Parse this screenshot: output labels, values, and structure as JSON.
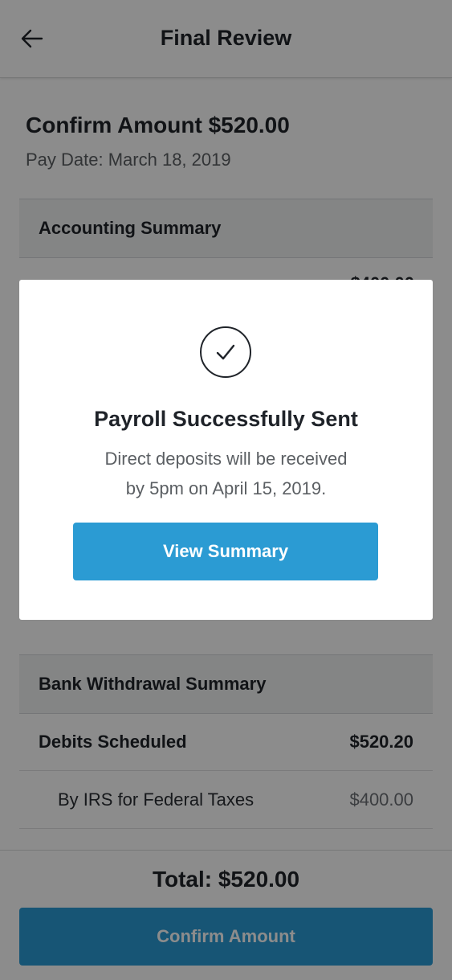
{
  "header": {
    "title": "Final Review",
    "back_icon": "arrow-left-icon"
  },
  "confirm": {
    "title": "Confirm Amount $520.00",
    "pay_date": "Pay Date: March 18, 2019"
  },
  "accounting_summary": {
    "title": "Accounting Summary",
    "first_row_partial_amount": "$400.00"
  },
  "bank_withdrawal_summary": {
    "title": "Bank Withdrawal Summary",
    "rows": [
      {
        "label": "Debits Scheduled",
        "amount": "$520.20",
        "style": "bold"
      },
      {
        "label": "By IRS for Federal Taxes",
        "amount": "$400.00",
        "style": "sub"
      }
    ]
  },
  "footer": {
    "total": "Total: $520.00",
    "confirm_button": "Confirm Amount"
  },
  "modal": {
    "icon": "check-circle-icon",
    "title": "Payroll Successfully Sent",
    "message_line1": "Direct deposits will be received",
    "message_line2": "by 5pm on April 15, 2019.",
    "button": "View Summary"
  },
  "colors": {
    "primary": "#2b9bd3",
    "text": "#1f2329",
    "muted": "#5b5f63",
    "overlay": "rgba(0,0,0,0.45)"
  }
}
